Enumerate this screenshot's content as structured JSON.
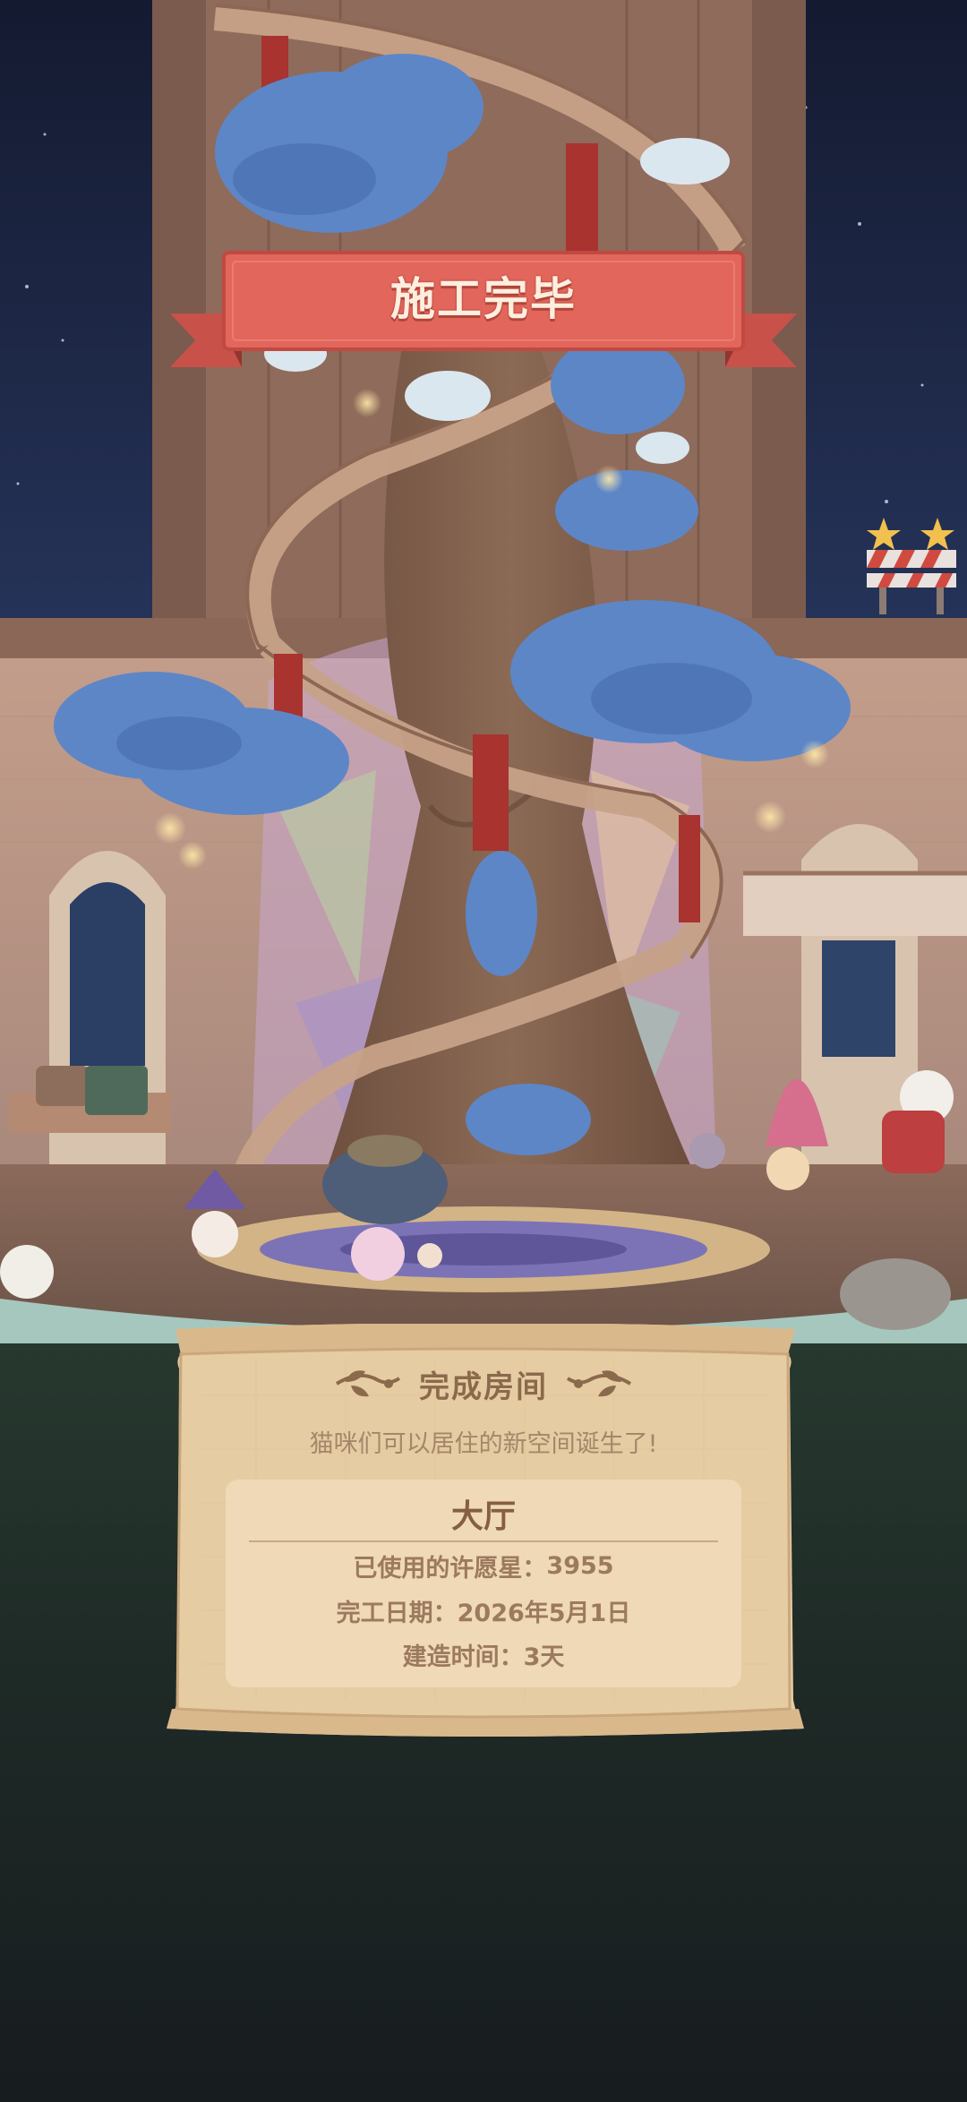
{
  "banner": {
    "title": "施工完毕"
  },
  "completion_panel": {
    "heading": "完成房间",
    "subtitle": "猫咪们可以居住的新空间诞生了!",
    "room_name": "大厅",
    "stars_used_label": "已使用的许愿星：",
    "stars_used_value": "3955",
    "completion_date_label": "完工日期：",
    "completion_date_value": "2026年5月1日",
    "build_time_label": "建造时间：",
    "build_time_value": "3天"
  },
  "icons": {
    "banner": "ribbon-banner-icon",
    "heading_left": "leaf-ornament-icon",
    "heading_right": "leaf-ornament-icon",
    "construction_badge": "star-barrier-icon"
  },
  "colors": {
    "banner_red": "#e2665b",
    "parchment": "#e9cfa6",
    "heading_brown": "#8b6a4c",
    "night_sky": "#1f2a48",
    "tree_blue": "#5b86c8",
    "trunk_brown": "#7c5d4a"
  }
}
